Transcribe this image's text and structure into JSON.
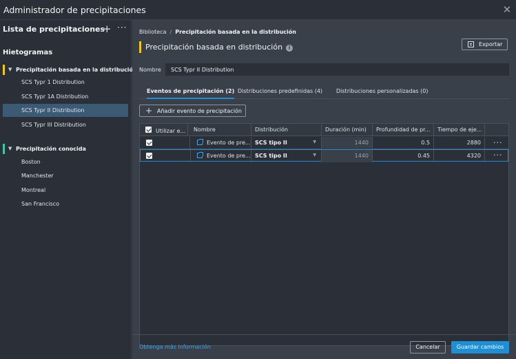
{
  "window": {
    "title": "Administrador de precipitaciones"
  },
  "sidebar": {
    "header": "Lista de precipitaciones",
    "section_title": "Hietogramas",
    "groups": [
      {
        "label": "Precipitación basada en la distribución",
        "accent": "#f2c811",
        "items": [
          "SCS Typr 1 Distribution",
          "SCS Typr 1A Distribution",
          "SCS Typr II Distribution",
          "SCS Typr III Distribution"
        ],
        "selected": "SCS Typr II Distribution"
      },
      {
        "label": "Precipitación conocida",
        "accent": "#3cc8a0",
        "items": [
          "Boston",
          "Manchester",
          "Montreal",
          "San Francisco"
        ]
      }
    ]
  },
  "main": {
    "breadcrumb": {
      "root": "Biblioteca",
      "separator": "/",
      "current": "Precipitación basada en la distribución"
    },
    "title": "Precipitación basada en distribución",
    "export_label": "Exportar",
    "name_label": "Nombre",
    "name_value": "SCS Typr II Distribution",
    "tabs": [
      {
        "label": "Eventos de precipitación (2)",
        "active": true
      },
      {
        "label": "Distribuciones predefinidas (4)",
        "active": false
      },
      {
        "label": "Distribuciones personalizadas (0)",
        "active": false
      }
    ],
    "add_event_label": "Añadir evento de precipitación",
    "table": {
      "columns": [
        "Utilizar e...",
        "Nombre",
        "Distribución",
        "Duración (min)",
        "Profundidad de pr...",
        "Tiempo de eje..."
      ],
      "rows": [
        {
          "checked": true,
          "name": "Evento de pre...",
          "distribution": "SCS tipo II",
          "duration": "1440",
          "depth": "0.5",
          "time": "2880"
        },
        {
          "checked": true,
          "name": "Evento de pre...",
          "distribution": "SCS tipo II",
          "duration": "1440",
          "depth": "0.45",
          "time": "4320"
        }
      ]
    },
    "footer": {
      "learn_more": "Obtenga más información",
      "cancel": "Cancelar",
      "save": "Guardar cambios"
    }
  },
  "colors": {
    "accent_blue": "#1e8fd5",
    "accent_yellow": "#f2c811",
    "accent_green": "#3cc8a0",
    "link": "#3da5ea"
  },
  "icons": [
    "close-icon",
    "plus-icon",
    "more-icon",
    "chevron-down-icon",
    "info-icon",
    "export-icon",
    "checkbox-icon",
    "external-link-icon"
  ]
}
